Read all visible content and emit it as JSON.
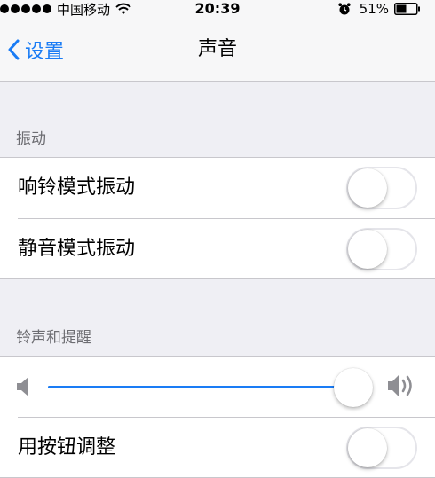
{
  "status_bar": {
    "carrier": "中国移动",
    "time": "20:39",
    "battery": "51%",
    "battery_level": 0.51
  },
  "nav": {
    "back_label": "设置",
    "title": "声音"
  },
  "vibrate_section": {
    "header": "振动",
    "items": [
      {
        "label": "响铃模式振动",
        "on": false
      },
      {
        "label": "静音模式振动",
        "on": false
      }
    ]
  },
  "ringer_section": {
    "header": "铃声和提醒",
    "volume_level": 0.95,
    "change_with_buttons": {
      "label": "用按钮调整",
      "on": false
    }
  },
  "colors": {
    "accent": "#1a7cf5",
    "background": "#efeff4",
    "separator": "#c8c7cc"
  },
  "icons": [
    "wifi-icon",
    "alarm-icon",
    "battery-icon",
    "chevron-left-icon",
    "volume-low-icon",
    "volume-high-icon"
  ]
}
